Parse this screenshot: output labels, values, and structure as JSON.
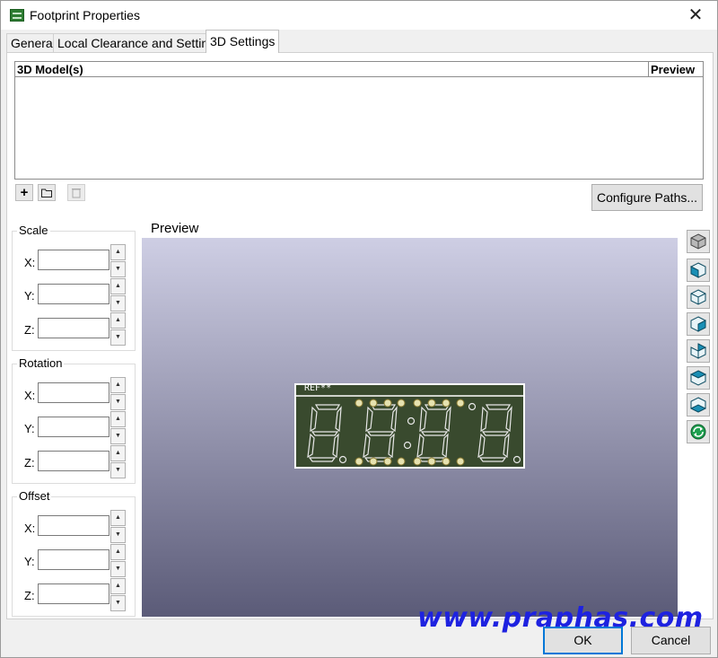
{
  "window": {
    "title": "Footprint Properties",
    "close": "✕"
  },
  "tabs": [
    {
      "label": "General"
    },
    {
      "label": "Local Clearance and Settings"
    },
    {
      "label": "3D Settings"
    }
  ],
  "models": {
    "header_models": "3D Model(s)",
    "header_preview": "Preview",
    "add": "+",
    "configure_paths": "Configure Paths..."
  },
  "scale": {
    "label": "Scale",
    "x": "X:",
    "y": "Y:",
    "z": "Z:"
  },
  "rotation": {
    "label": "Rotation",
    "x": "X:",
    "y": "Y:",
    "z": "Z:"
  },
  "offset": {
    "label": "Offset",
    "x": "X:",
    "y": "Y:",
    "z": "Z:"
  },
  "preview": {
    "label": "Preview",
    "ref": "REF**"
  },
  "view_buttons": [
    "cube-icon",
    "view-front-icon",
    "view-back-icon",
    "view-left-icon",
    "view-right-icon",
    "view-top-icon",
    "view-bottom-icon",
    "reload-icon"
  ],
  "watermark": "www.praphas.com",
  "buttons": {
    "ok": "OK",
    "cancel": "Cancel"
  },
  "colors": {
    "accent": "#0078d7",
    "arrow": "#22dd22",
    "watermark": "#1e22e0",
    "pcb": "#394a2e"
  }
}
